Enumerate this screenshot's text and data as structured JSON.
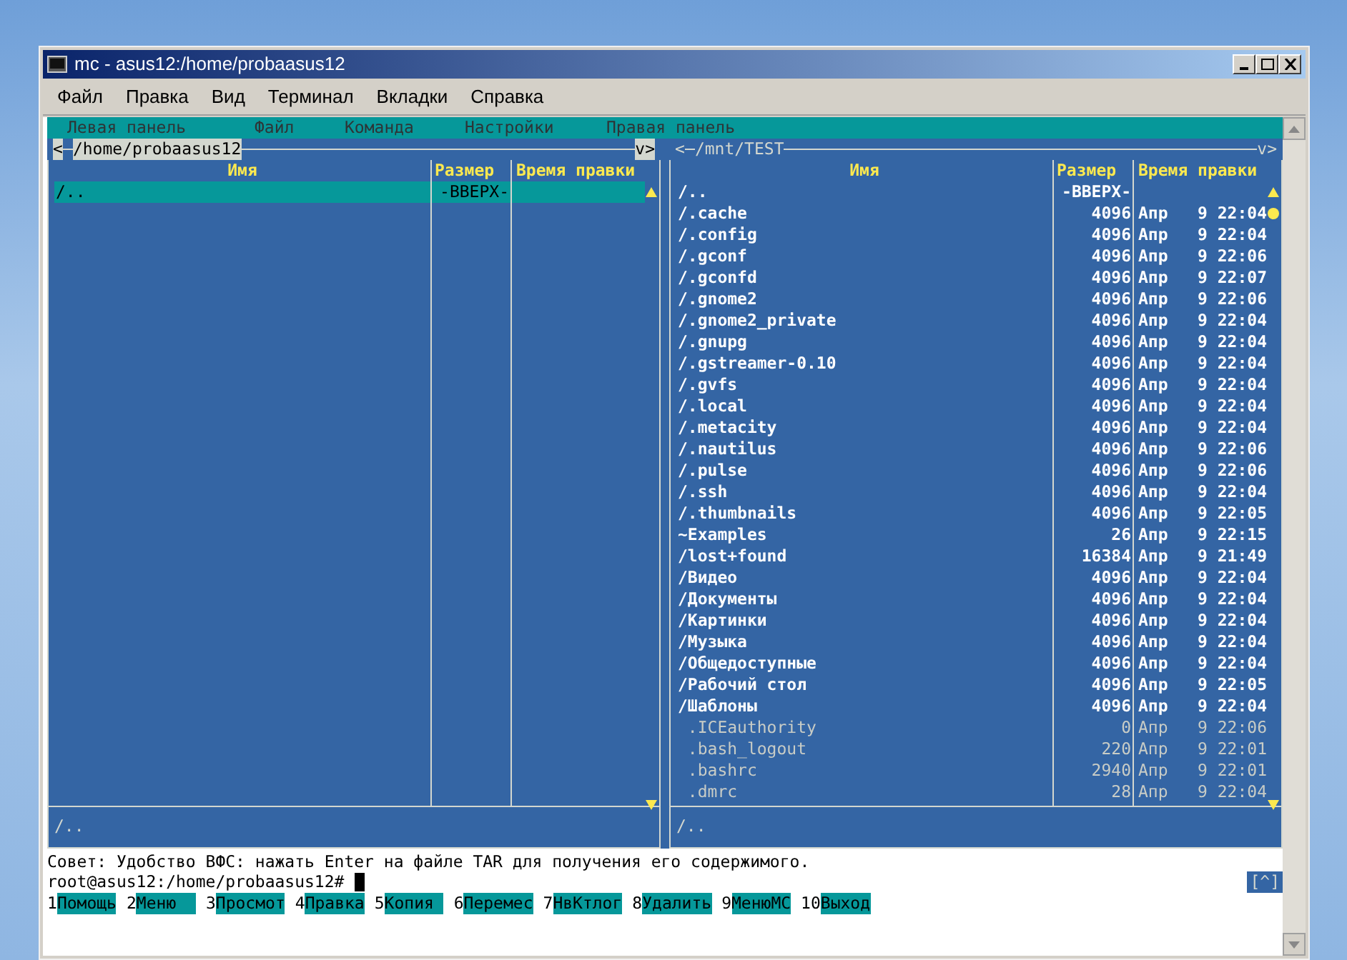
{
  "window": {
    "title": "mc - asus12:/home/probaasus12"
  },
  "menu": [
    "Файл",
    "Правка",
    "Вид",
    "Терминал",
    "Вкладки",
    "Справка"
  ],
  "mc_menu": [
    "Левая панель",
    "Файл",
    "Команда",
    "Настройки",
    "Правая панель"
  ],
  "panels": [
    {
      "nav_left": "<",
      "nav_right": "v>",
      "path": "/home/probaasus12",
      "active": true,
      "columns": [
        "Имя",
        "Размер",
        "Время правки"
      ],
      "mini_status": "/..",
      "entries": [
        {
          "name": "/..",
          "size": "-ВВЕРХ-",
          "kind": "dir",
          "selected": true
        }
      ]
    },
    {
      "nav_left": "<",
      "nav_right": "v>",
      "path": "/mnt/TEST",
      "active": false,
      "columns": [
        "Имя",
        "Размер",
        "Время правки"
      ],
      "mini_status": "/..",
      "entries": [
        {
          "name": "/..",
          "size": "-ВВЕРХ-",
          "kind": "dir",
          "selected": false
        },
        {
          "name": "/.cache",
          "size": "4096",
          "time": "Апр   9 22:04",
          "kind": "dir",
          "selected": false
        },
        {
          "name": "/.config",
          "size": "4096",
          "time": "Апр   9 22:04",
          "kind": "dir",
          "selected": false
        },
        {
          "name": "/.gconf",
          "size": "4096",
          "time": "Апр   9 22:06",
          "kind": "dir",
          "selected": false
        },
        {
          "name": "/.gconfd",
          "size": "4096",
          "time": "Апр   9 22:07",
          "kind": "dir",
          "selected": false
        },
        {
          "name": "/.gnome2",
          "size": "4096",
          "time": "Апр   9 22:06",
          "kind": "dir",
          "selected": false
        },
        {
          "name": "/.gnome2_private",
          "size": "4096",
          "time": "Апр   9 22:04",
          "kind": "dir",
          "selected": false
        },
        {
          "name": "/.gnupg",
          "size": "4096",
          "time": "Апр   9 22:04",
          "kind": "dir",
          "selected": false
        },
        {
          "name": "/.gstreamer-0.10",
          "size": "4096",
          "time": "Апр   9 22:04",
          "kind": "dir",
          "selected": false
        },
        {
          "name": "/.gvfs",
          "size": "4096",
          "time": "Апр   9 22:04",
          "kind": "dir",
          "selected": false
        },
        {
          "name": "/.local",
          "size": "4096",
          "time": "Апр   9 22:04",
          "kind": "dir",
          "selected": false
        },
        {
          "name": "/.metacity",
          "size": "4096",
          "time": "Апр   9 22:04",
          "kind": "dir",
          "selected": false
        },
        {
          "name": "/.nautilus",
          "size": "4096",
          "time": "Апр   9 22:06",
          "kind": "dir",
          "selected": false
        },
        {
          "name": "/.pulse",
          "size": "4096",
          "time": "Апр   9 22:06",
          "kind": "dir",
          "selected": false
        },
        {
          "name": "/.ssh",
          "size": "4096",
          "time": "Апр   9 22:04",
          "kind": "dir",
          "selected": false
        },
        {
          "name": "/.thumbnails",
          "size": "4096",
          "time": "Апр   9 22:05",
          "kind": "dir",
          "selected": false
        },
        {
          "name": "~Examples",
          "size": "26",
          "time": "Апр   9 22:15",
          "kind": "dir",
          "selected": false
        },
        {
          "name": "/lost+found",
          "size": "16384",
          "time": "Апр   9 21:49",
          "kind": "dir",
          "selected": false
        },
        {
          "name": "/Видео",
          "size": "4096",
          "time": "Апр   9 22:04",
          "kind": "dir",
          "selected": false
        },
        {
          "name": "/Документы",
          "size": "4096",
          "time": "Апр   9 22:04",
          "kind": "dir",
          "selected": false
        },
        {
          "name": "/Картинки",
          "size": "4096",
          "time": "Апр   9 22:04",
          "kind": "dir",
          "selected": false
        },
        {
          "name": "/Музыка",
          "size": "4096",
          "time": "Апр   9 22:04",
          "kind": "dir",
          "selected": false
        },
        {
          "name": "/Общедоступные",
          "size": "4096",
          "time": "Апр   9 22:04",
          "kind": "dir",
          "selected": false
        },
        {
          "name": "/Рабочий стол",
          "size": "4096",
          "time": "Апр   9 22:05",
          "kind": "dir",
          "selected": false
        },
        {
          "name": "/Шаблоны",
          "size": "4096",
          "time": "Апр   9 22:04",
          "kind": "dir",
          "selected": false
        },
        {
          "name": " .ICEauthority",
          "size": "0",
          "time": "Апр   9 22:06",
          "kind": "file",
          "selected": false
        },
        {
          "name": " .bash_logout",
          "size": "220",
          "time": "Апр   9 22:01",
          "kind": "file",
          "selected": false
        },
        {
          "name": " .bashrc",
          "size": "2940",
          "time": "Апр   9 22:01",
          "kind": "file",
          "selected": false
        },
        {
          "name": " .dmrc",
          "size": "28",
          "time": "Апр   9 22:04",
          "kind": "file",
          "selected": false
        }
      ]
    }
  ],
  "hint": "Совет: Удобство ВФС: нажать Enter на файле TAR для получения его содержимого.",
  "prompt": "root@asus12:/home/probaasus12#",
  "scroll_button": "[^]",
  "fkeys": [
    {
      "key": "1",
      "label": "Помощь"
    },
    {
      "key": "2",
      "label": "Меню  "
    },
    {
      "key": "3",
      "label": "Просмот"
    },
    {
      "key": "4",
      "label": "Правка"
    },
    {
      "key": "5",
      "label": "Копия "
    },
    {
      "key": "6",
      "label": "Перемес"
    },
    {
      "key": "7",
      "label": "НвКтлог"
    },
    {
      "key": "8",
      "label": "Удалить"
    },
    {
      "key": "9",
      "label": "МенюMC"
    },
    {
      "key": "10",
      "label": "Выход"
    }
  ]
}
